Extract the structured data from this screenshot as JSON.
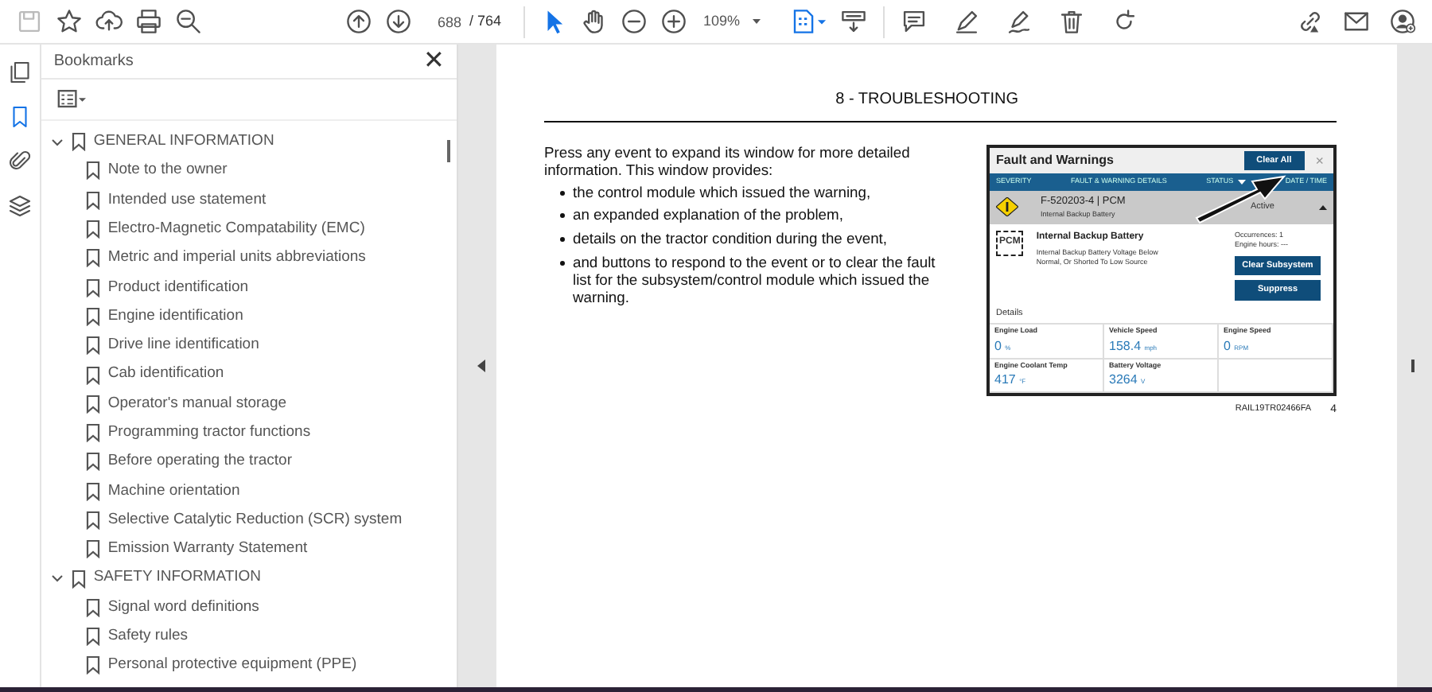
{
  "toolbar": {
    "page": "688",
    "page_count": "/ 764",
    "zoom": "109%",
    "tools": [
      {
        "kind": "select",
        "selected": true
      },
      {
        "kind": "hand",
        "selected": false
      }
    ]
  },
  "side_tabs": [
    {
      "kind": "pages",
      "selected": false
    },
    {
      "kind": "bookmarks",
      "selected": true
    },
    {
      "kind": "attachments",
      "selected": false
    },
    {
      "kind": "layers",
      "selected": false
    }
  ],
  "bookmarks": {
    "title": "Bookmarks",
    "close": "✕",
    "items": [
      {
        "label": "GENERAL INFORMATION",
        "expanded": true,
        "children": [
          {
            "label": "Note to the owner"
          },
          {
            "label": "Intended use statement"
          },
          {
            "label": "Electro-Magnetic Compatability (EMC)"
          },
          {
            "label": "Metric and imperial units abbreviations"
          },
          {
            "label": "Product identification"
          },
          {
            "label": "Engine identification"
          },
          {
            "label": "Drive line identification"
          },
          {
            "label": "Cab identification"
          },
          {
            "label": "Operator's manual storage"
          },
          {
            "label": "Programming tractor functions"
          },
          {
            "label": "Before operating the tractor"
          },
          {
            "label": "Machine orientation"
          },
          {
            "label": "Selective Catalytic Reduction (SCR) system"
          },
          {
            "label": "Emission Warranty Statement"
          }
        ]
      },
      {
        "label": "SAFETY INFORMATION",
        "expanded": true,
        "children": [
          {
            "label": "Signal word definitions"
          },
          {
            "label": "Safety rules"
          },
          {
            "label": "Personal protective equipment (PPE)"
          }
        ]
      }
    ]
  },
  "document": {
    "header": "8 - TROUBLESHOOTING",
    "intro": "Press any event to expand its window for more detailed information.  This window provides:",
    "bullets": [
      "the control module which issued the warning,",
      "an expanded explanation of the problem,",
      "details on the tractor condition during the event,",
      "and buttons to respond to the event or to clear the fault list for the subsystem/control module which issued the warning."
    ],
    "figure": {
      "title": "Fault and Warnings",
      "clear_all": "Clear All",
      "close": "×",
      "columns": [
        "SEVERITY",
        "FAULT & WARNING DETAILS",
        "STATUS",
        "DATE / TIME"
      ],
      "event": {
        "code": "F-520203-4 | PCM",
        "subtitle": "Internal Backup Battery",
        "status": "Active",
        "expanded": true
      },
      "module": "PCM",
      "detail_title": "Internal Backup Battery",
      "description": "Internal Backup Battery Voltage Below Normal, Or Shorted To Low Source",
      "occurrences": "Occurrences: 1",
      "engine_hours": "Engine hours: ---",
      "buttons": [
        "Clear Subsystem",
        "Suppress"
      ],
      "details_heading": "Details",
      "readings": [
        {
          "label": "Engine Load",
          "value": "0",
          "unit": "%"
        },
        {
          "label": "Vehicle Speed",
          "value": "158.4",
          "unit": "mph"
        },
        {
          "label": "Engine Speed",
          "value": "0",
          "unit": "RPM"
        },
        {
          "label": "Engine Coolant Temp",
          "value": "417",
          "unit": "°F"
        },
        {
          "label": "Battery Voltage",
          "value": "3264",
          "unit": "V"
        }
      ]
    },
    "caption": "RAIL19TR02466FA",
    "figure_number": "4"
  }
}
